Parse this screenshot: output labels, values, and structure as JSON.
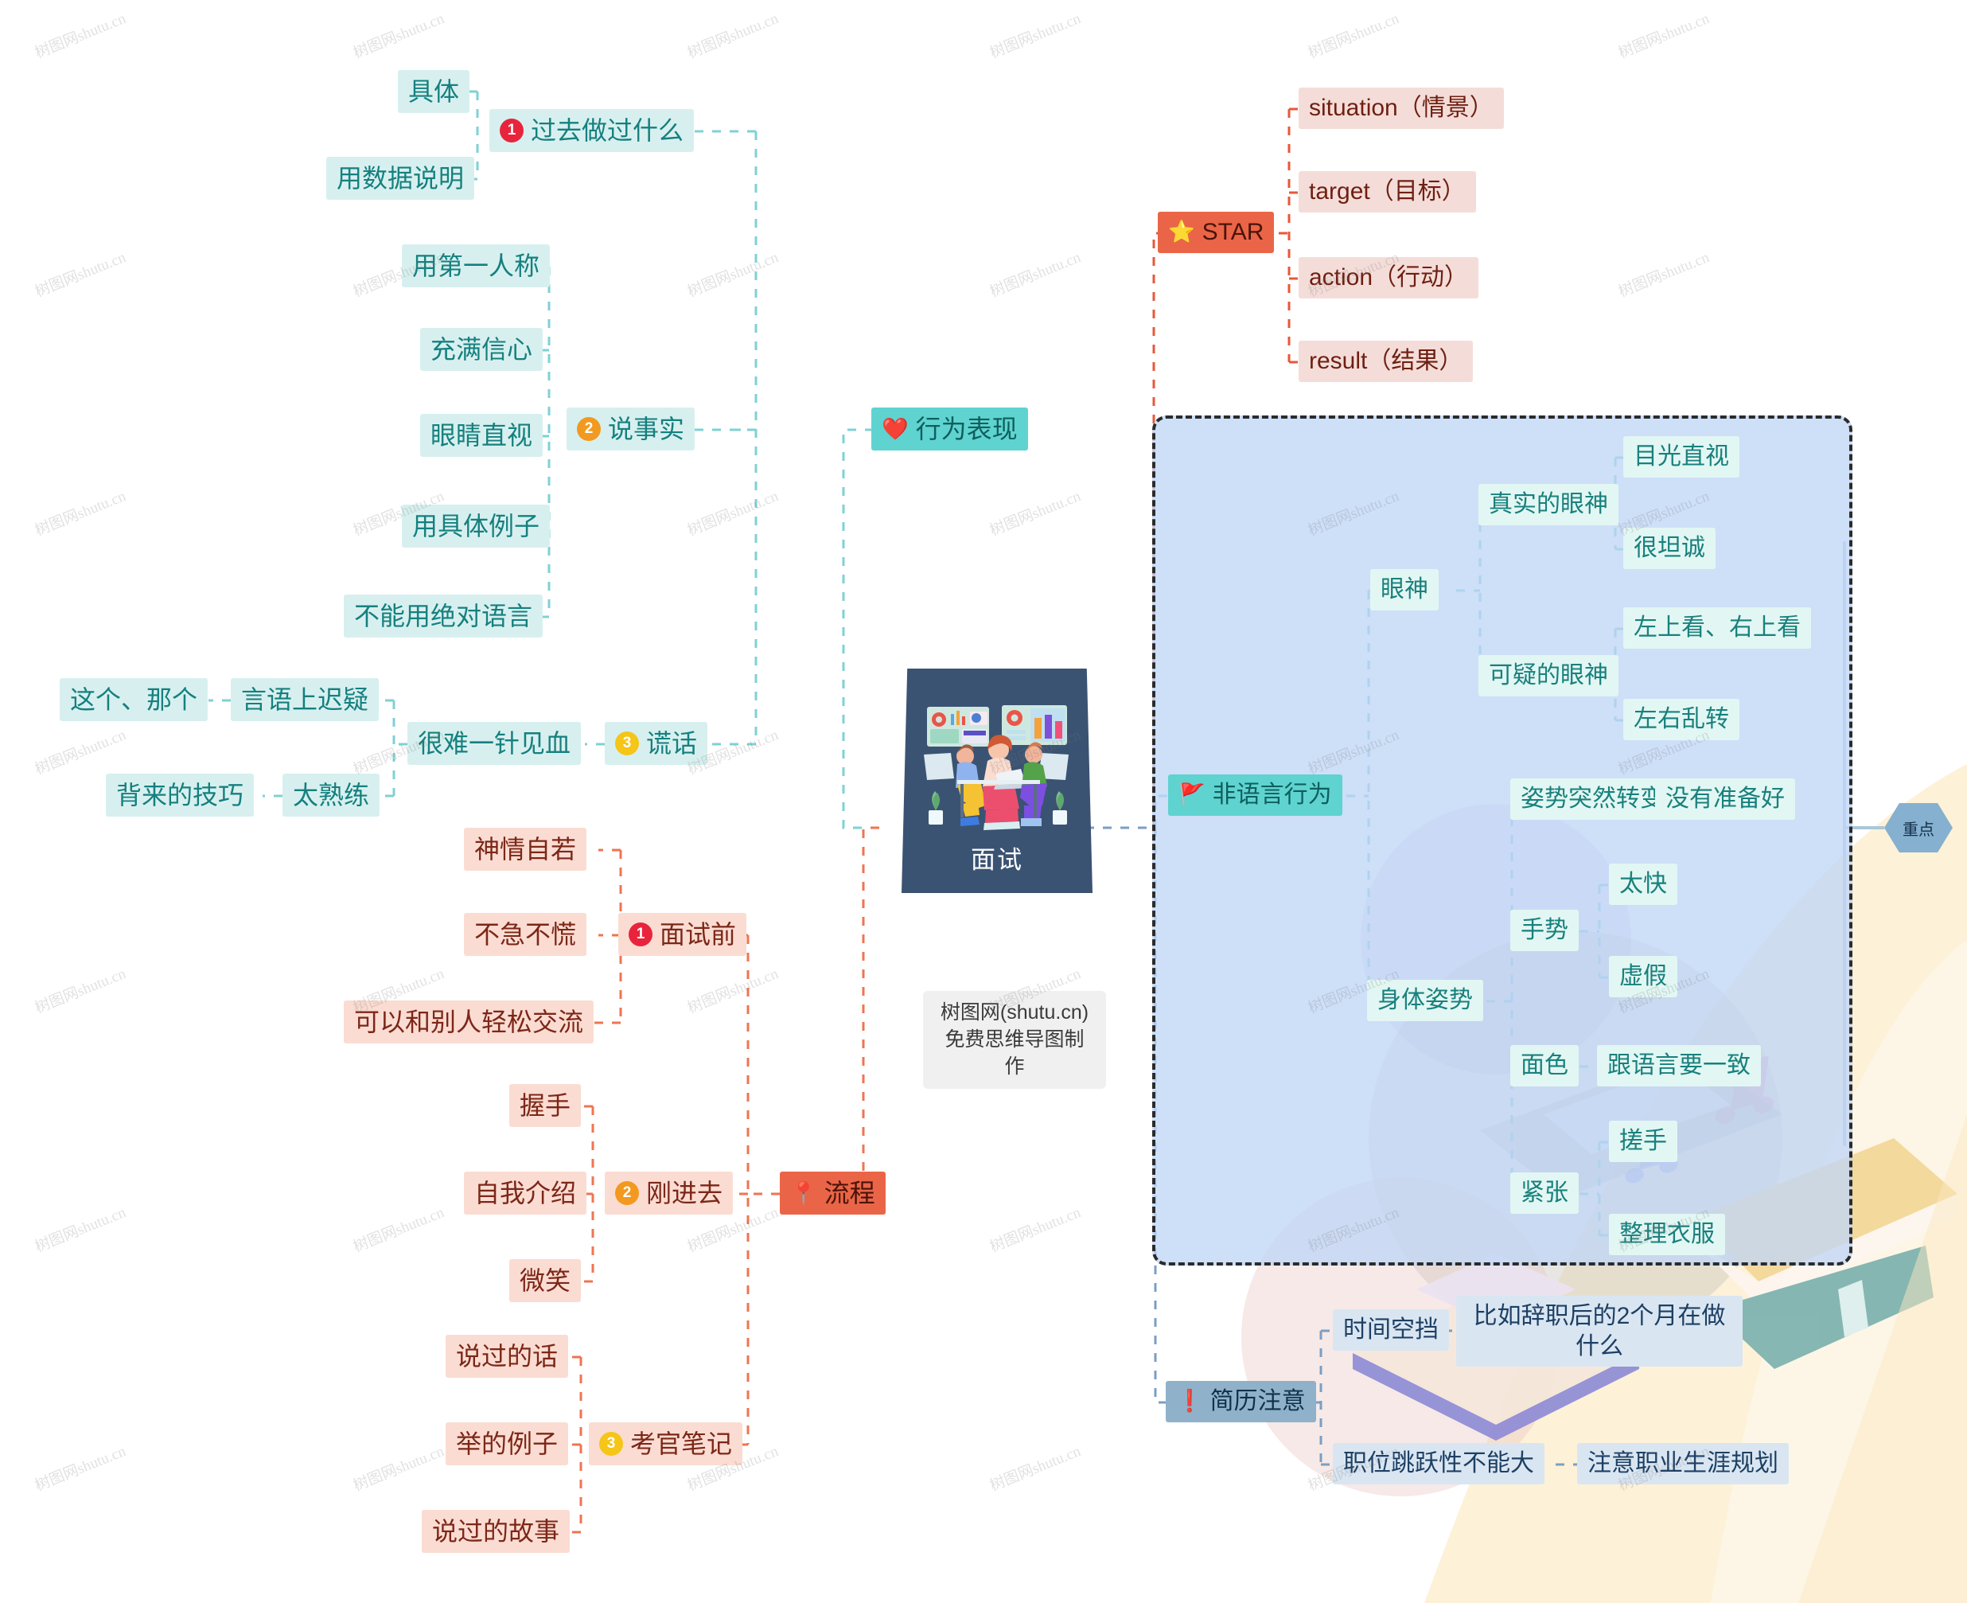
{
  "title": "面试",
  "credit": {
    "line1": "树图网(shutu.cn)",
    "line2": "免费思维导图制作"
  },
  "focus_marker": "重点",
  "branches": {
    "behavior": {
      "label": "行为表现",
      "icon": "heart-icon",
      "sub": [
        {
          "num": "1",
          "label": "过去做过什么",
          "leaves": [
            "具体",
            "用数据说明"
          ]
        },
        {
          "num": "2",
          "label": "说事实",
          "leaves": [
            "用第一人称",
            "充满信心",
            "眼睛直视",
            "用具体例子",
            "不能用绝对语言"
          ]
        },
        {
          "num": "3",
          "label": "谎话",
          "leaves": [
            {
              "label": "很难一针见血",
              "children": [
                {
                  "label": "言语上迟疑",
                  "children": [
                    "这个、那个"
                  ]
                },
                {
                  "label": "太熟练",
                  "children": [
                    "背来的技巧"
                  ]
                }
              ]
            }
          ]
        }
      ]
    },
    "process": {
      "label": "流程",
      "icon": "location-pin-icon",
      "sub": [
        {
          "num": "1",
          "label": "面试前",
          "leaves": [
            "神情自若",
            "不急不慌",
            "可以和别人轻松交流"
          ]
        },
        {
          "num": "2",
          "label": "刚进去",
          "leaves": [
            "握手",
            "自我介绍",
            "微笑"
          ]
        },
        {
          "num": "3",
          "label": "考官笔记",
          "leaves": [
            "说过的话",
            "举的例子",
            "说过的故事"
          ]
        }
      ]
    },
    "star": {
      "label": "STAR",
      "icon": "star-icon",
      "leaves": [
        "situation（情景）",
        "target（目标）",
        "action（行动）",
        "result（结果）"
      ]
    },
    "nonverbal": {
      "label": "非语言行为",
      "icon": "flag-icon",
      "groups": [
        {
          "label": "眼神",
          "children": [
            {
              "label": "真实的眼神",
              "leaves": [
                "目光直视",
                "很坦诚"
              ]
            },
            {
              "label": "可疑的眼神",
              "leaves": [
                "左上看、右上看",
                "左右乱转"
              ]
            }
          ]
        },
        {
          "label": "身体姿势",
          "children": [
            {
              "label": "姿势突然转变",
              "leaves": [
                "没有准备好"
              ]
            },
            {
              "label": "手势",
              "leaves": [
                "太快",
                "虚假"
              ]
            },
            {
              "label": "面色",
              "leaves": [
                "跟语言要一致"
              ]
            },
            {
              "label": "紧张",
              "leaves": [
                "搓手",
                "整理衣服"
              ]
            }
          ]
        }
      ]
    },
    "resume": {
      "label": "简历注意",
      "icon": "exclamation-icon",
      "leaves": [
        {
          "label": "时间空挡",
          "children": [
            "比如辞职后的2个月在做什么"
          ]
        },
        {
          "label": "职位跳跃性不能大",
          "children": [
            "注意职业生涯规划"
          ]
        }
      ]
    }
  },
  "watermark": "树图网shutu.cn",
  "colors": {
    "teal_pale": "#d7f0ef",
    "teal_solid": "#5fd3d0",
    "pink_pale": "#fbdcd2",
    "orange_solid": "#ea6547",
    "blue_slate": "#8fb2ca",
    "region_fill": "#c0d6f6",
    "central": "#3b5372"
  }
}
